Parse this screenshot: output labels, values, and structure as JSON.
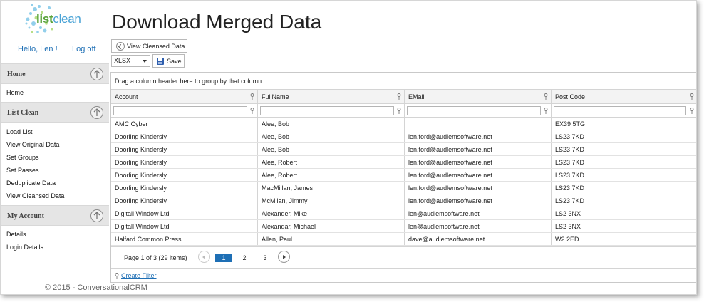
{
  "app": {
    "logo_text_part1": "list",
    "logo_text_part2": "clean",
    "page_title": "Download Merged Data",
    "copyright": "© 2015 - ConversationalCRM"
  },
  "user": {
    "greeting": "Hello, Len !",
    "logoff_label": "Log off"
  },
  "sidebar": {
    "sections": [
      {
        "title": "Home",
        "items": [
          "Home"
        ]
      },
      {
        "title": "List Clean",
        "items": [
          "Load List",
          "View Original Data",
          "Set Groups",
          "Set Passes",
          "Deduplicate Data",
          "View Cleansed Data"
        ]
      },
      {
        "title": "My Account",
        "items": [
          "Details",
          "Login Details"
        ]
      }
    ]
  },
  "toolbar": {
    "view_cleansed_label": "View Cleansed Data",
    "format_value": "XLSX",
    "save_label": "Save"
  },
  "grid": {
    "group_hint": "Drag a column header here to group by that column",
    "columns": [
      "Account",
      "FullName",
      "EMail",
      "Post Code"
    ],
    "rows": [
      [
        "AMC Cyber",
        "Alee, Bob",
        "",
        "EX39 5TG"
      ],
      [
        "Doorling Kindersly",
        "Alee, Bob",
        "len.ford@audlemsoftware.net",
        "LS23 7KD"
      ],
      [
        "Doorling Kindersly",
        "Alee, Bob",
        "len.ford@audlemsoftware.net",
        "LS23 7KD"
      ],
      [
        "Doorling Kindersly",
        "Alee, Robert",
        "len.ford@audlemsoftware.net",
        "LS23 7KD"
      ],
      [
        "Doorling Kindersly",
        "Alee, Robert",
        "len.ford@audlemsoftware.net",
        "LS23 7KD"
      ],
      [
        "Doorling Kindersly",
        "MacMillan, James",
        "len.ford@audlemsoftware.net",
        "LS23 7KD"
      ],
      [
        "Doorling Kindersly",
        "McMilan, Jimmy",
        "len.ford@audlemsoftware.net",
        "LS23 7KD"
      ],
      [
        "Digitall Window Ltd",
        "Alexander, Mike",
        "len@audlemsoftware.net",
        "LS2 3NX"
      ],
      [
        "Digitall Window Ltd",
        "Alexandar, Michael",
        "len@audlemsoftware.net",
        "LS2 3NX"
      ],
      [
        "Halfard Common Press",
        "Allen, Paul",
        "dave@audlemsoftware.net",
        "W2 2ED"
      ]
    ],
    "pager": {
      "info": "Page 1 of 3 (29 items)",
      "pages": [
        "1",
        "2",
        "3"
      ],
      "current_page": "1"
    },
    "create_filter_label": "Create Filter"
  },
  "colors": {
    "accent": "#1e6fb5",
    "section_bg": "#e5e5e5",
    "logo_green": "#5aa33a",
    "logo_blue": "#4aa3d6"
  }
}
